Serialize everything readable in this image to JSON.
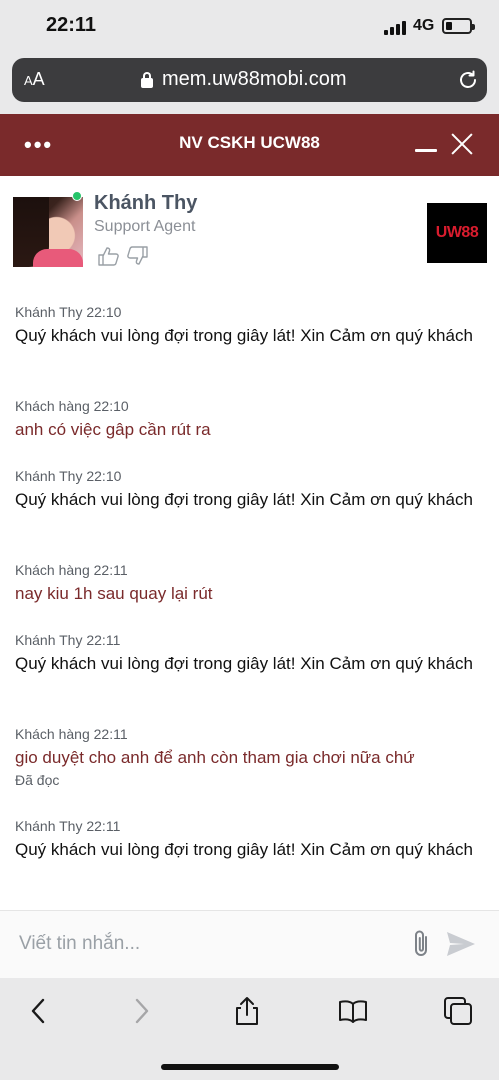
{
  "status_bar": {
    "time": "22:11",
    "network": "4G"
  },
  "browser": {
    "aa_label_small": "A",
    "aa_label_large": "A",
    "url": "mem.uw88mobi.com"
  },
  "header": {
    "menu_label": "•••",
    "title": "NV CSKH UCW88"
  },
  "agent": {
    "name": "Khánh Thy",
    "role": "Support Agent",
    "logo_text": "UW88"
  },
  "messages": [
    {
      "sender": "Khánh Thy",
      "time": "22:10",
      "text": "Quý khách vui lòng đợi trong giây lát! Xin Cảm ơn quý khách"
    },
    {
      "sender": "Khách hàng",
      "time": "22:10",
      "text": "anh có việc gâp cần rút ra"
    },
    {
      "sender": "Khánh Thy",
      "time": "22:10",
      "text": "Quý khách vui lòng đợi trong giây lát! Xin Cảm ơn quý khách"
    },
    {
      "sender": "Khách hàng",
      "time": "22:11",
      "text": "nay kiu 1h sau quay lại rút"
    },
    {
      "sender": "Khánh Thy",
      "time": "22:11",
      "text": "Quý khách vui lòng đợi trong giây lát! Xin Cảm ơn quý khách"
    },
    {
      "sender": "Khách hàng",
      "time": "22:11",
      "text": "gio duyệt cho anh để anh còn tham gia chơi nữa chứ",
      "status": "Đã đọc"
    },
    {
      "sender": "Khánh Thy",
      "time": "22:11",
      "text": "Quý khách vui lòng đợi trong giây lát! Xin Cảm ơn quý khách"
    }
  ],
  "composer": {
    "placeholder": "Viết tin nhắn..."
  },
  "colors": {
    "header_bg": "#7a2a2b",
    "customer_text": "#7a2a2b",
    "online": "#27c46a",
    "logo_red": "#d91c2e"
  },
  "icons": [
    "signal-icon",
    "battery-icon",
    "lock-icon",
    "reload-icon",
    "close-icon",
    "minimize-icon",
    "thumbs-up-icon",
    "thumbs-down-icon",
    "attach-icon",
    "send-icon",
    "back-icon",
    "forward-icon",
    "share-icon",
    "bookmarks-icon",
    "tabs-icon"
  ]
}
